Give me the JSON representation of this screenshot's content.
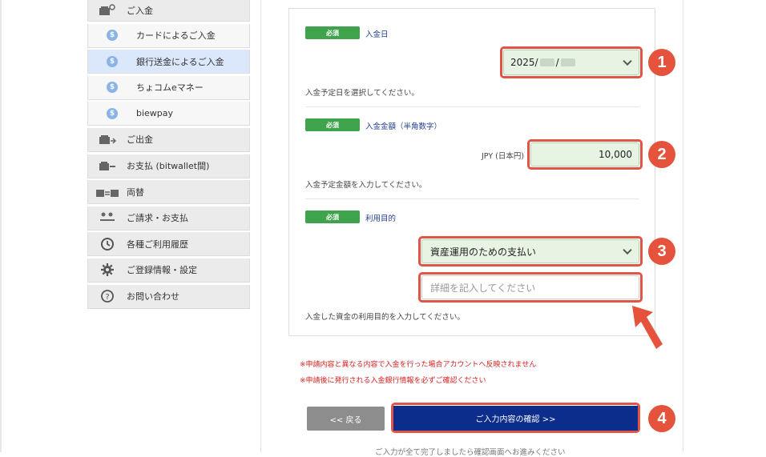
{
  "sidebar": {
    "items": [
      {
        "label": "ご入金",
        "icon": "deposit-icon"
      },
      {
        "label": "カードによるご入金",
        "icon": "coin-icon"
      },
      {
        "label": "銀行送金によるご入金",
        "icon": "coin-icon",
        "active": true
      },
      {
        "label": "ちょコムeマネー",
        "icon": "coin-icon"
      },
      {
        "label": "biewpay",
        "icon": "coin-icon"
      },
      {
        "label": "ご出金",
        "icon": "withdraw-icon"
      },
      {
        "label": "お支払 (bitwallet間)",
        "icon": "payment-icon"
      },
      {
        "label": "両替",
        "icon": "exchange-icon"
      },
      {
        "label": "ご請求・お支払",
        "icon": "users-icon"
      },
      {
        "label": "各種ご利用履歴",
        "icon": "history-icon"
      },
      {
        "label": "ご登録情報・設定",
        "icon": "gear-icon"
      },
      {
        "label": "お問い合わせ",
        "icon": "question-icon"
      }
    ]
  },
  "form": {
    "required_label": "必須",
    "date": {
      "label": "入金日",
      "value_prefix": "2025/",
      "value_sep": "/",
      "hint": "入金予定日を選択してください。"
    },
    "amount": {
      "label": "入金金額（半角数字）",
      "currency": "JPY (日本円)",
      "value": "10,000",
      "hint": "入金予定金額を入力してください。"
    },
    "purpose": {
      "label": "利用目的",
      "selected": "資産運用のための支払い",
      "detail_placeholder": "詳細を記入してください",
      "hint": "入金した資金の利用目的を入力してください。"
    }
  },
  "warnings": [
    "※申請内容と異なる内容で入金を行った場合アカウントへ反映されません",
    "※申請後に発行される入金銀行情報を必ずご確認ください"
  ],
  "buttons": {
    "back": "<< 戻る",
    "confirm": "ご入力内容の確認 >>"
  },
  "footer_text": "ご入力が全て完了しましたら確認画面へお進みください",
  "badges": [
    "1",
    "2",
    "3",
    "4"
  ],
  "colors": {
    "highlight": "#e05545",
    "required": "#3fa34d",
    "confirm_button": "#0d2d8c",
    "warning": "#d92020"
  }
}
